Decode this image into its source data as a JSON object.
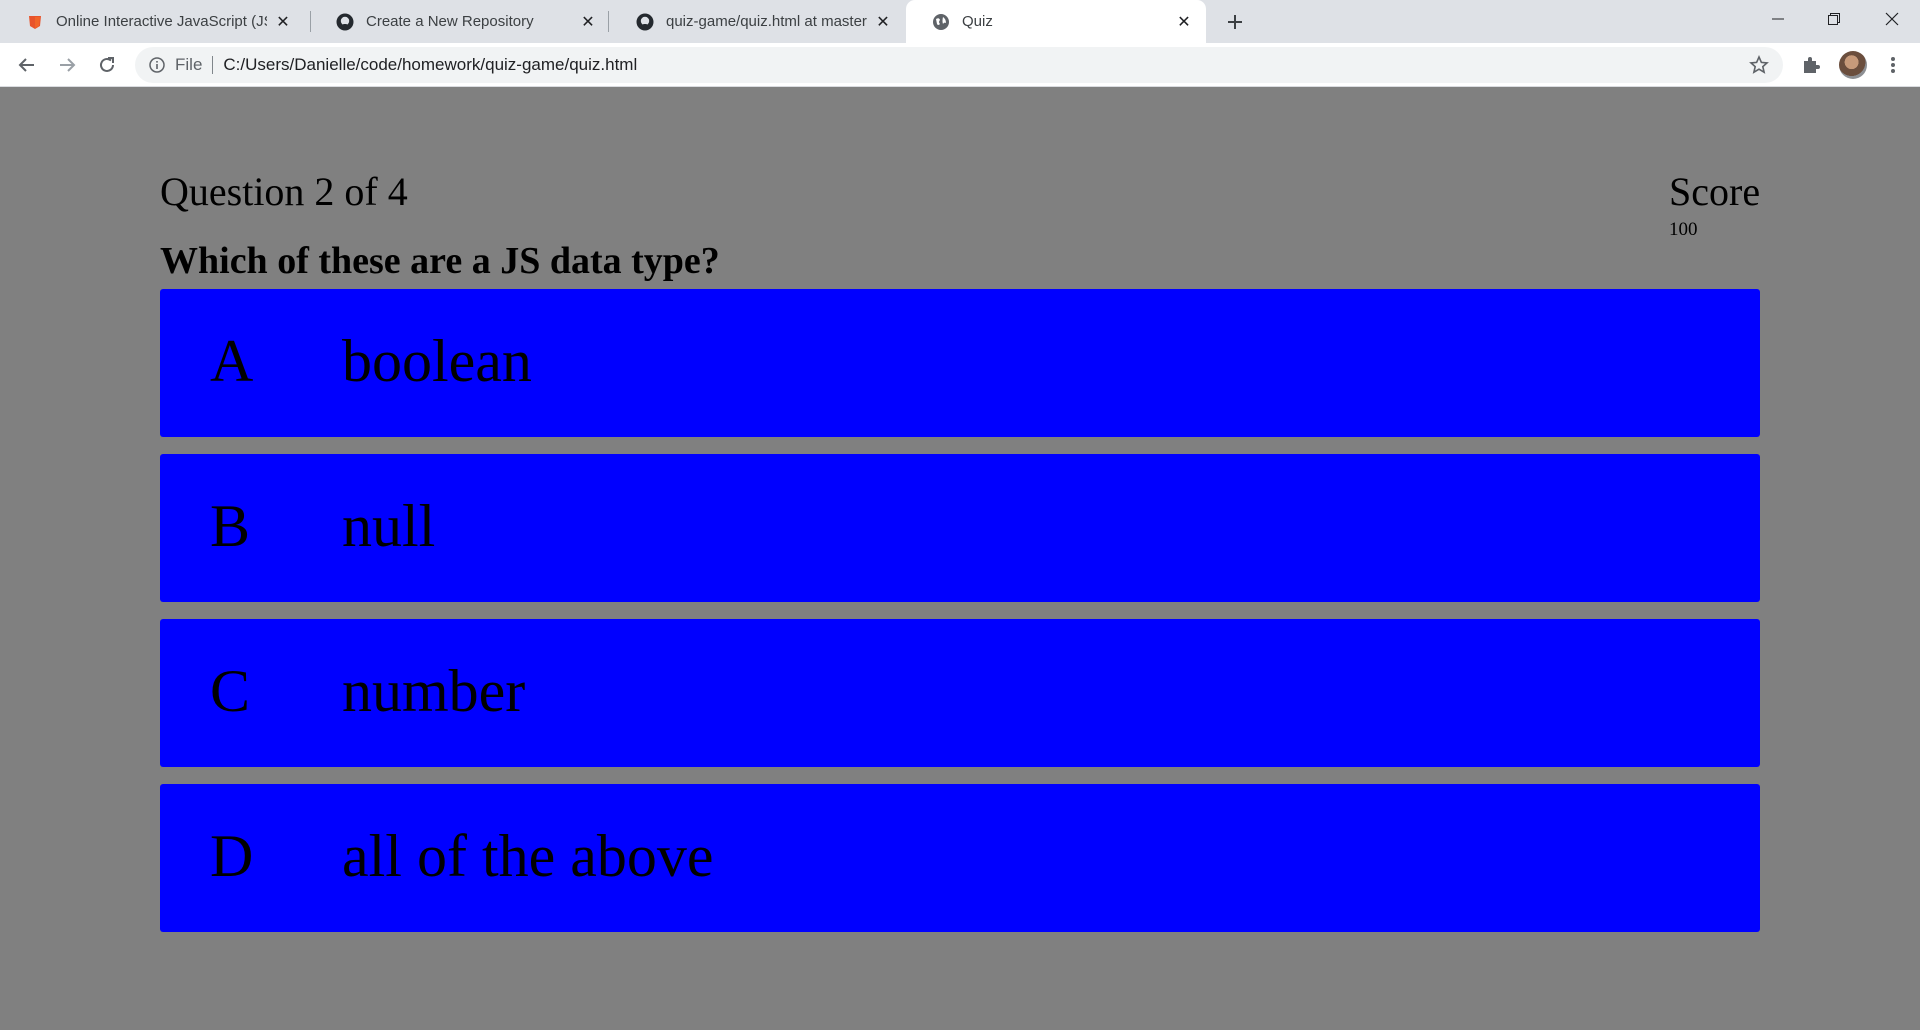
{
  "browser": {
    "tabs": [
      {
        "title": "Online Interactive JavaScript (JS) Cheat Sheet",
        "icon": "orange-shield-icon",
        "active": false
      },
      {
        "title": "Create a New Repository",
        "icon": "github-icon",
        "active": false
      },
      {
        "title": "quiz-game/quiz.html at master · Danielle",
        "icon": "github-icon",
        "active": false
      },
      {
        "title": "Quiz",
        "icon": "globe-icon",
        "active": true
      }
    ],
    "address": {
      "scheme": "File",
      "url": "C:/Users/Danielle/code/homework/quiz-game/quiz.html"
    }
  },
  "quiz": {
    "progress": "Question 2 of 4",
    "score_label": "Score",
    "score_value": "100",
    "question": "Which of these are a JS data type?",
    "answers": [
      {
        "letter": "A",
        "text": "boolean"
      },
      {
        "letter": "B",
        "text": "null"
      },
      {
        "letter": "C",
        "text": "number"
      },
      {
        "letter": "D",
        "text": "all of the above"
      }
    ]
  },
  "colors": {
    "page_background": "#808080",
    "answer_background": "#0000ff",
    "text": "#000000"
  }
}
